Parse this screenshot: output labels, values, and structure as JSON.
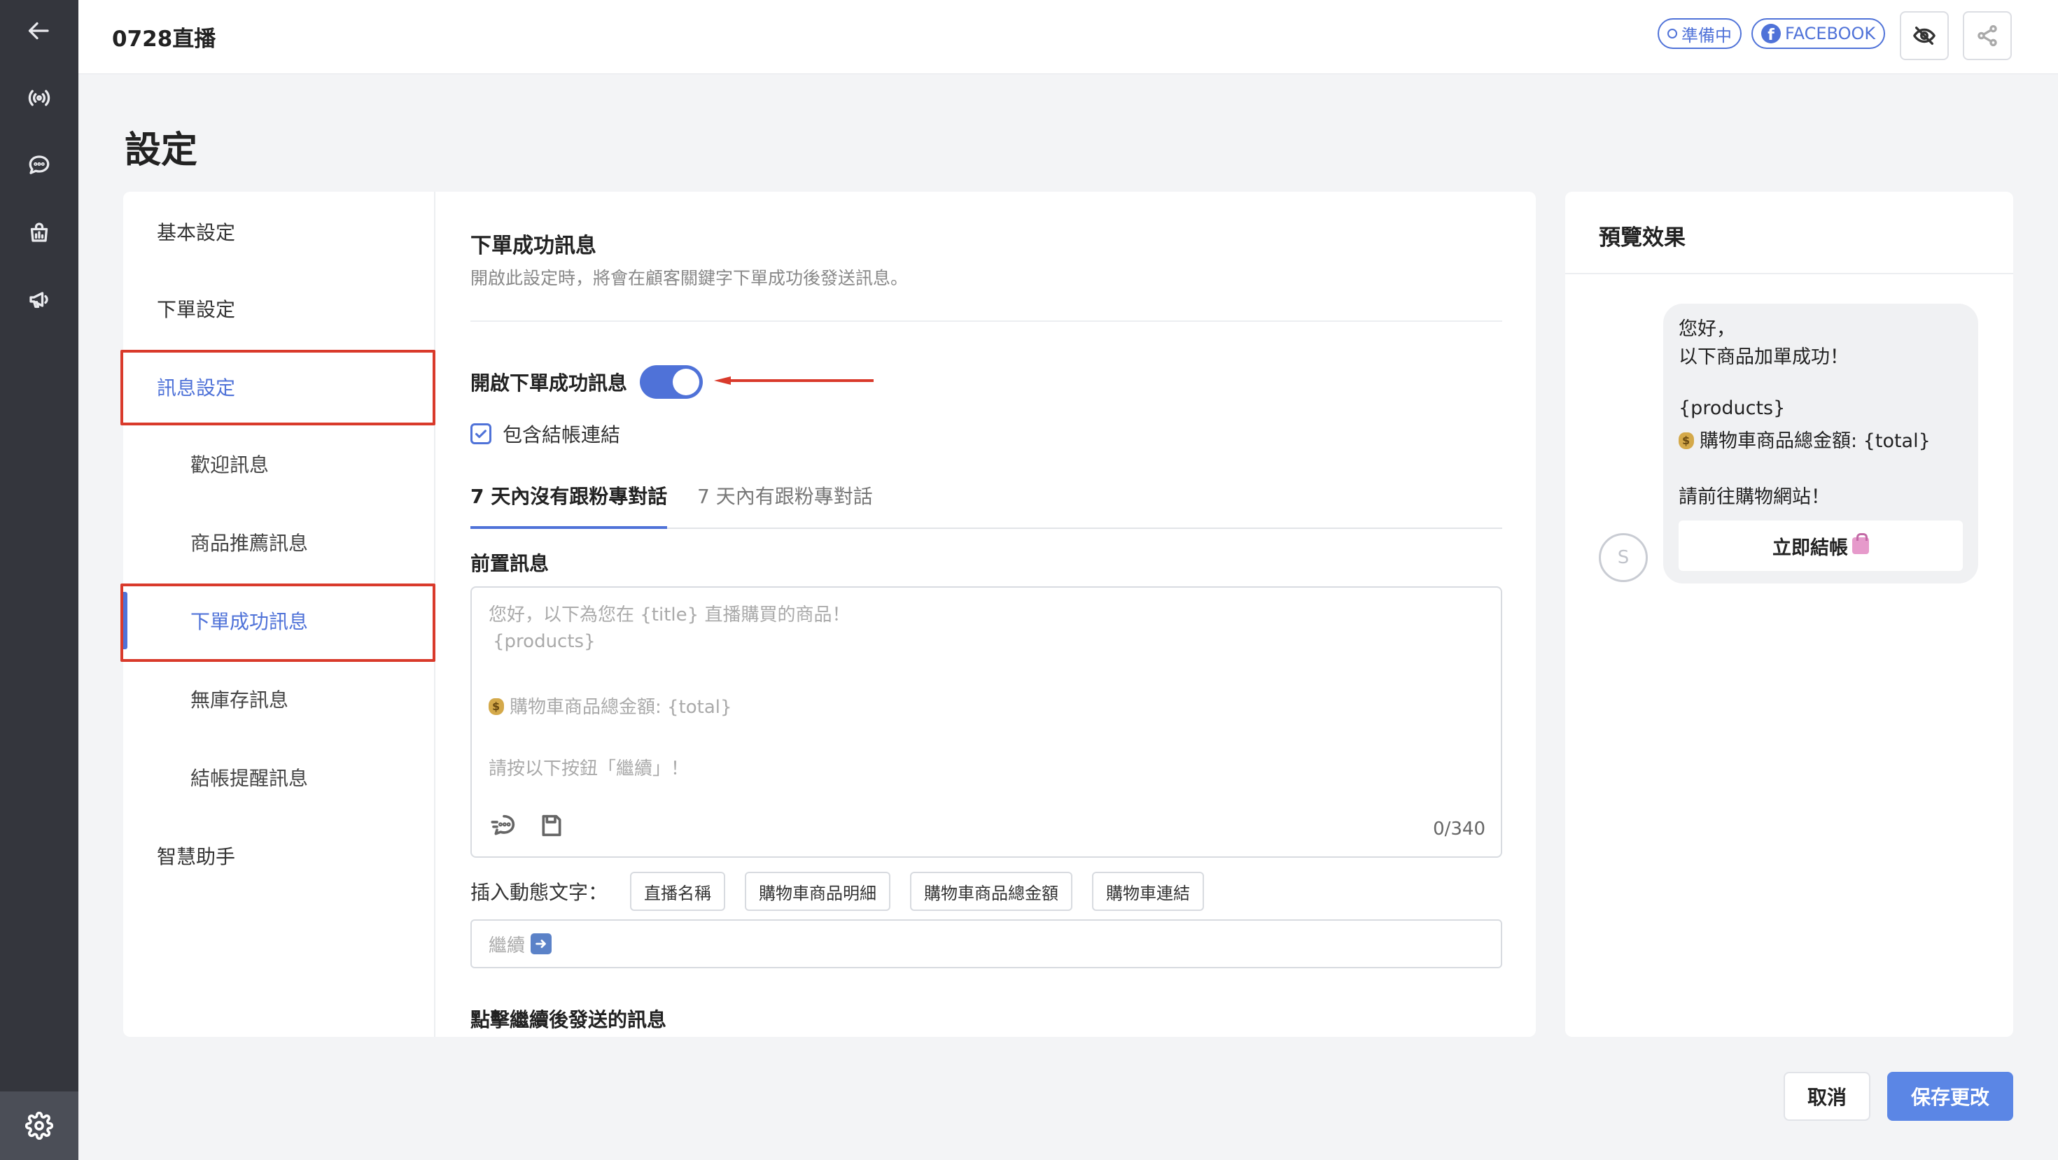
{
  "header": {
    "title": "0728直播",
    "status_pill": "準備中",
    "platform_pill": "FACEBOOK"
  },
  "page": {
    "title": "設定"
  },
  "side_nav": {
    "items": [
      {
        "label": "基本設定"
      },
      {
        "label": "下單設定"
      },
      {
        "label": "訊息設定"
      },
      {
        "label": "歡迎訊息"
      },
      {
        "label": "商品推薦訊息"
      },
      {
        "label": "下單成功訊息"
      },
      {
        "label": "無庫存訊息"
      },
      {
        "label": "結帳提醒訊息"
      },
      {
        "label": "智慧助手"
      }
    ]
  },
  "section": {
    "title": "下單成功訊息",
    "description": "開啟此設定時，將會在顧客關鍵字下單成功後發送訊息。",
    "toggle_label": "開啟下單成功訊息",
    "checkbox_label": "包含結帳連結",
    "tabs": [
      {
        "label": "7 天內沒有跟粉專對話"
      },
      {
        "label": "7 天內有跟粉專對話"
      }
    ],
    "pre_message_label": "前置訊息",
    "pre_message_lines": [
      "您好，以下為您在 {title} 直播購買的商品！",
      "{products}",
      "購物車商品總金額: {total}",
      "請按以下按鈕「繼續」！"
    ],
    "char_count": "0/340",
    "insert_label": "插入動態文字：",
    "insert_chips": [
      "直播名稱",
      "購物車商品明細",
      "購物車商品總金額",
      "購物車連結"
    ],
    "continue_placeholder": "繼續",
    "after_continue_label": "點擊繼續後發送的訊息"
  },
  "preview": {
    "title": "預覽效果",
    "avatar_letter": "S",
    "bubble_lines": [
      "您好，",
      "以下商品加單成功！",
      "{products}",
      "購物車商品總金額: {total}",
      "請前往購物網站！"
    ],
    "button_label": "立即結帳"
  },
  "footer": {
    "cancel_label": "取消",
    "save_label": "保存更改"
  },
  "colors": {
    "accent": "#4f72d8",
    "highlight": "#d93a2b",
    "rail": "#34363d"
  }
}
